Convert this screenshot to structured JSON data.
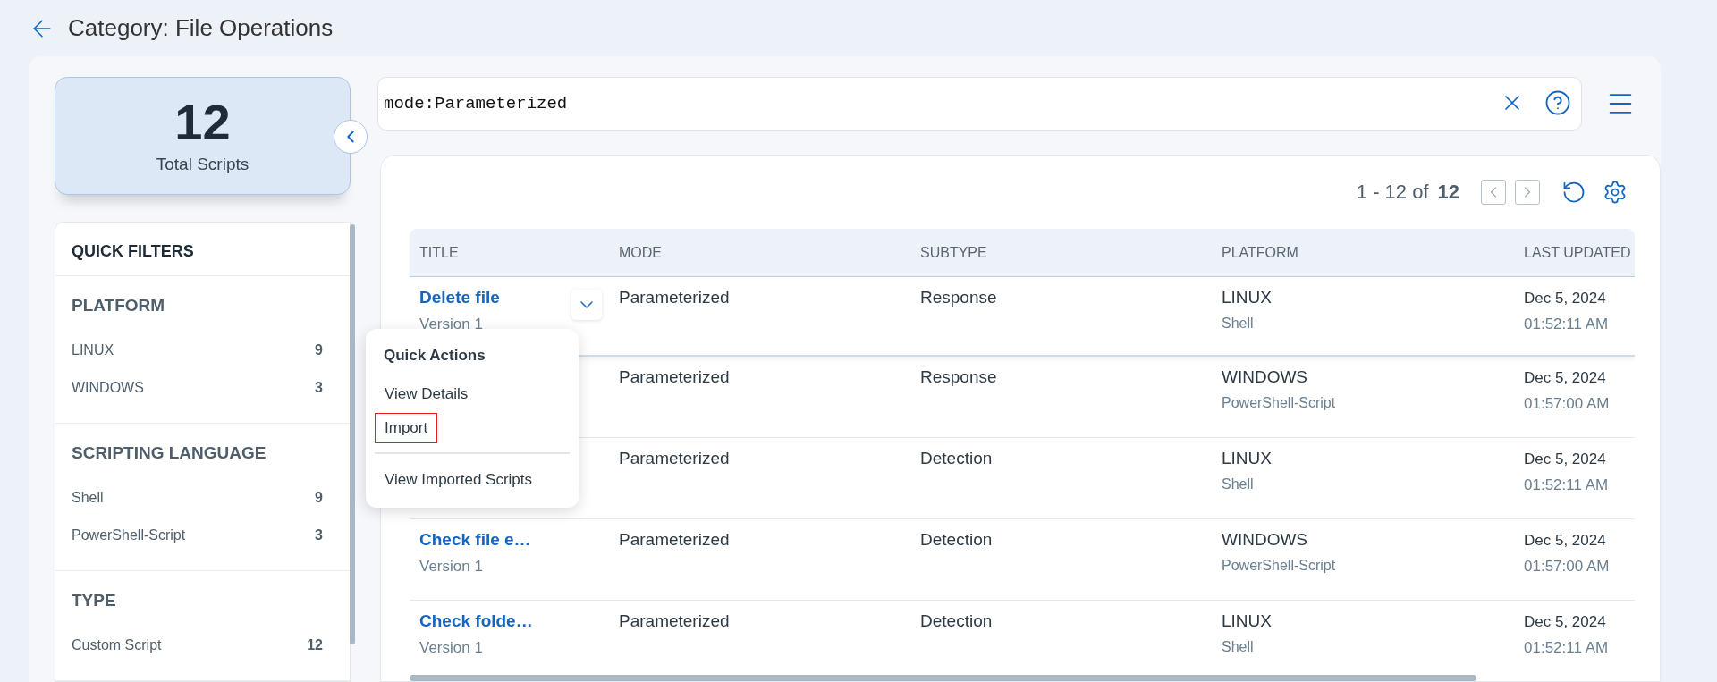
{
  "header": {
    "title": "Category: File Operations"
  },
  "summary": {
    "count": "12",
    "label": "Total Scripts"
  },
  "quick_filters": {
    "title": "QUICK FILTERS",
    "sections": [
      {
        "title": "PLATFORM",
        "items": [
          {
            "label": "LINUX",
            "count": "9"
          },
          {
            "label": "WINDOWS",
            "count": "3"
          }
        ]
      },
      {
        "title": "SCRIPTING LANGUAGE",
        "items": [
          {
            "label": "Shell",
            "count": "9"
          },
          {
            "label": "PowerShell-Script",
            "count": "3"
          }
        ]
      },
      {
        "title": "TYPE",
        "items": [
          {
            "label": "Custom Script",
            "count": "12"
          }
        ]
      }
    ]
  },
  "search": {
    "value": "mode:Parameterized"
  },
  "pagination": {
    "range": "1 - 12 of",
    "total": "12"
  },
  "table": {
    "columns": [
      "TITLE",
      "MODE",
      "SUBTYPE",
      "PLATFORM",
      "LAST UPDATED"
    ],
    "rows": [
      {
        "selected": true,
        "title": "Delete file",
        "version": "Version 1",
        "mode": "Parameterized",
        "subtype": "Response",
        "platform": "LINUX",
        "language": "Shell",
        "date": "Dec 5, 2024",
        "time": "01:52:11 AM"
      },
      {
        "selected": false,
        "mode": "Parameterized",
        "subtype": "Response",
        "platform": "WINDOWS",
        "language": "PowerShell-Script",
        "date": "Dec 5, 2024",
        "time": "01:57:00 AM"
      },
      {
        "selected": false,
        "mode": "Parameterized",
        "subtype": "Detection",
        "platform": "LINUX",
        "language": "Shell",
        "date": "Dec 5, 2024",
        "time": "01:52:11 AM"
      },
      {
        "selected": false,
        "title": "Check file e…",
        "version": "Version 1",
        "mode": "Parameterized",
        "subtype": "Detection",
        "platform": "WINDOWS",
        "language": "PowerShell-Script",
        "date": "Dec 5, 2024",
        "time": "01:57:00 AM"
      },
      {
        "selected": false,
        "title": "Check folde…",
        "version": "Version 1",
        "mode": "Parameterized",
        "subtype": "Detection",
        "platform": "LINUX",
        "language": "Shell",
        "date": "Dec 5, 2024",
        "time": "01:52:11 AM"
      }
    ]
  },
  "quick_actions_menu": {
    "title": "Quick Actions",
    "groups": [
      [
        {
          "label": "View Details",
          "highlighted": false
        },
        {
          "label": "Import",
          "highlighted": true
        }
      ],
      [
        {
          "label": "View Imported Scripts",
          "highlighted": false
        }
      ]
    ]
  }
}
